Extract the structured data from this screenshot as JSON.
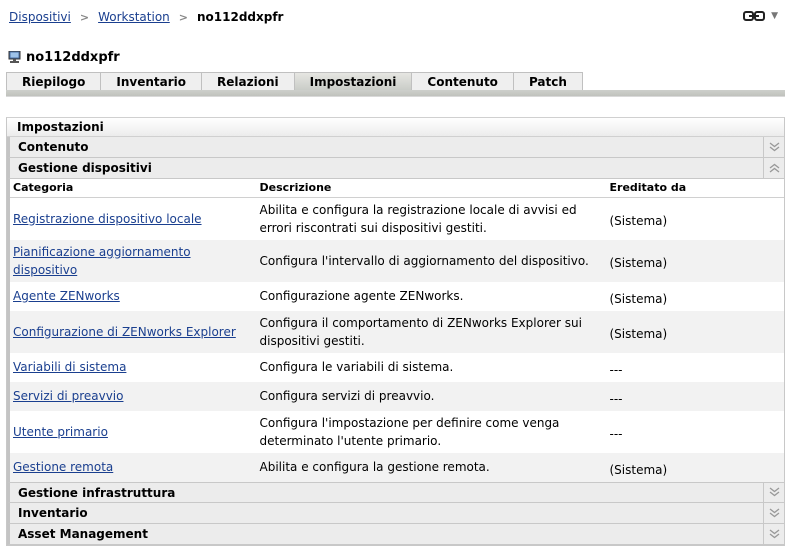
{
  "breadcrumb": {
    "items": [
      "Dispositivi",
      "Workstation"
    ],
    "current": "no112ddxpfr"
  },
  "device": {
    "name": "no112ddxpfr",
    "icon": "workstation-icon"
  },
  "tabs": [
    {
      "label": "Riepilogo",
      "active": false
    },
    {
      "label": "Inventario",
      "active": false
    },
    {
      "label": "Relazioni",
      "active": false
    },
    {
      "label": "Impostazioni",
      "active": true
    },
    {
      "label": "Contenuto",
      "active": false
    },
    {
      "label": "Patch",
      "active": false
    }
  ],
  "panel": {
    "title": "Impostazioni",
    "sections_before": [
      {
        "label": "Contenuto",
        "state": "collapsed"
      },
      {
        "label": "Gestione dispositivi",
        "state": "expanded"
      }
    ],
    "table": {
      "headers": [
        "Categoria",
        "Descrizione",
        "Ereditato da"
      ],
      "rows": [
        {
          "category": "Registrazione dispositivo locale",
          "description": "Abilita e configura la registrazione locale di avvisi ed errori riscontrati sui dispositivi gestiti.",
          "inherited": "(Sistema)"
        },
        {
          "category": "Pianificazione aggiornamento dispositivo",
          "description": "Configura l'intervallo di aggiornamento del dispositivo.",
          "inherited": "(Sistema)"
        },
        {
          "category": "Agente ZENworks",
          "description": "Configurazione agente ZENworks.",
          "inherited": "(Sistema)"
        },
        {
          "category": "Configurazione di ZENworks Explorer",
          "description": "Configura il comportamento di ZENworks Explorer sui dispositivi gestiti.",
          "inherited": "(Sistema)"
        },
        {
          "category": "Variabili di sistema",
          "description": "Configura le variabili di sistema.",
          "inherited": "---"
        },
        {
          "category": "Servizi di preavvio",
          "description": "Configura servizi di preavvio.",
          "inherited": "---"
        },
        {
          "category": "Utente primario",
          "description": "Configura l'impostazione per definire come venga determinato l'utente primario.",
          "inherited": "---"
        },
        {
          "category": "Gestione remota",
          "description": "Abilita e configura la gestione remota.",
          "inherited": "(Sistema)"
        }
      ]
    },
    "sections_after": [
      {
        "label": "Gestione infrastruttura",
        "state": "collapsed"
      },
      {
        "label": "Inventario",
        "state": "collapsed"
      },
      {
        "label": "Asset Management",
        "state": "collapsed"
      }
    ]
  }
}
